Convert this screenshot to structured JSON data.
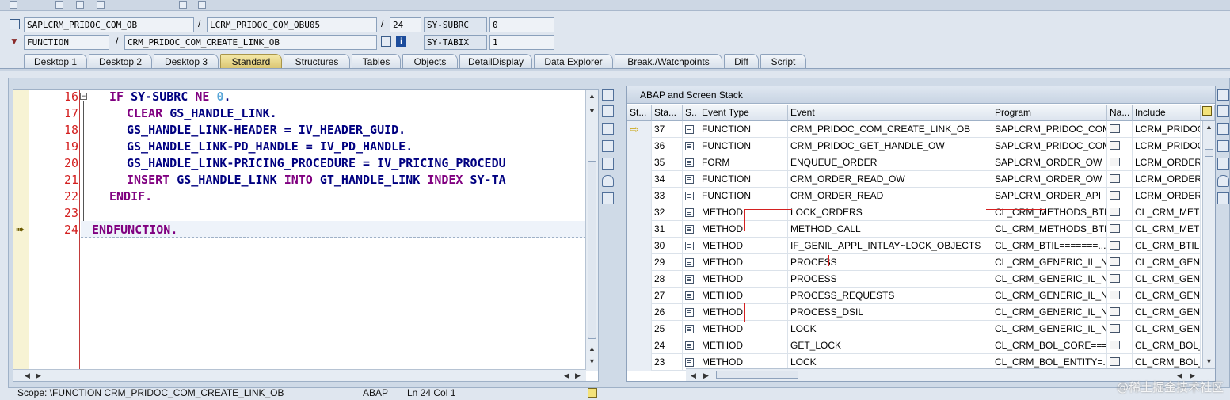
{
  "header": {
    "row1": {
      "program": "SAPLCRM_PRIDOC_COM_OB",
      "include": "LCRM_PRIDOC_COM_OBU05",
      "line": "24",
      "var_name": "SY-SUBRC",
      "var_value": "0",
      "sep": "/"
    },
    "row2": {
      "event_type": "FUNCTION",
      "event": "CRM_PRIDOC_COM_CREATE_LINK_OB",
      "var_name": "SY-TABIX",
      "var_value": "1",
      "sep": "/"
    }
  },
  "tabs": [
    {
      "label": "Desktop 1"
    },
    {
      "label": "Desktop 2"
    },
    {
      "label": "Desktop 3"
    },
    {
      "label": "Standard"
    },
    {
      "label": "Structures"
    },
    {
      "label": "Tables"
    },
    {
      "label": "Objects"
    },
    {
      "label": "DetailDisplay"
    },
    {
      "label": "Data Explorer"
    },
    {
      "label": "Break./Watchpoints"
    },
    {
      "label": "Diff"
    },
    {
      "label": "Script"
    }
  ],
  "active_tab": "Standard",
  "editor": {
    "lines": [
      {
        "num": "16",
        "p1": "IF ",
        "p2": "SY-SUBRC ",
        "p3": "NE ",
        "p4": "0",
        "p5": "."
      },
      {
        "num": "17",
        "p1": "CLEAR ",
        "p2": "GS_HANDLE_LINK."
      },
      {
        "num": "18",
        "p1": "GS_HANDLE_LINK-HEADER = IV_HEADER_GUID."
      },
      {
        "num": "19",
        "p1": "GS_HANDLE_LINK-PD_HANDLE = IV_PD_HANDLE."
      },
      {
        "num": "20",
        "p1": "GS_HANDLE_LINK-PRICING_PROCEDURE = IV_PRICING_PROCEDU"
      },
      {
        "num": "21",
        "p1": "INSERT ",
        "p2": "GS_HANDLE_LINK ",
        "p3": "INTO ",
        "p4": "GT_HANDLE_LINK ",
        "p5": "INDEX ",
        "p6": "SY-TA"
      },
      {
        "num": "22",
        "p1": "ENDIF."
      },
      {
        "num": "23"
      },
      {
        "num": "24",
        "p1": "ENDFUNCTION."
      }
    ]
  },
  "status_bar": {
    "scope": "Scope: \\FUNCTION CRM_PRIDOC_COM_CREATE_LINK_OB",
    "language": "ABAP",
    "position": "Ln  24 Col   1"
  },
  "stack": {
    "title": "ABAP and Screen Stack",
    "columns": [
      "St...",
      "Sta...",
      "S..",
      "Event Type",
      "Event",
      "Program",
      "Na...",
      "Include"
    ],
    "rows": [
      {
        "level": "37",
        "event_type": "FUNCTION",
        "event": "CRM_PRIDOC_COM_CREATE_LINK_OB",
        "program": "SAPLCRM_PRIDOC_COM...",
        "include": "LCRM_PRIDOC_"
      },
      {
        "level": "36",
        "event_type": "FUNCTION",
        "event": "CRM_PRIDOC_GET_HANDLE_OW",
        "program": "SAPLCRM_PRIDOC_COM...",
        "include": "LCRM_PRIDOC_"
      },
      {
        "level": "35",
        "event_type": "FORM",
        "event": "ENQUEUE_ORDER",
        "program": "SAPLCRM_ORDER_OW",
        "include": "LCRM_ORDER_("
      },
      {
        "level": "34",
        "event_type": "FUNCTION",
        "event": "CRM_ORDER_READ_OW",
        "program": "SAPLCRM_ORDER_OW",
        "include": "LCRM_ORDER_("
      },
      {
        "level": "33",
        "event_type": "FUNCTION",
        "event": "CRM_ORDER_READ",
        "program": "SAPLCRM_ORDER_API",
        "include": "LCRM_ORDER_A"
      },
      {
        "level": "32",
        "event_type": "METHOD",
        "event": "LOCK_ORDERS",
        "program": "CL_CRM_METHODS_BTIL...",
        "include": "CL_CRM_METHO"
      },
      {
        "level": "31",
        "event_type": "METHOD",
        "event": "METHOD_CALL",
        "program": "CL_CRM_METHODS_BTIL...",
        "include": "CL_CRM_METHO"
      },
      {
        "level": "30",
        "event_type": "METHOD",
        "event": "IF_GENIL_APPL_INTLAY~LOCK_OBJECTS",
        "program": "CL_CRM_BTIL=======...",
        "include": "CL_CRM_BTIL="
      },
      {
        "level": "29",
        "event_type": "METHOD",
        "event": "PROCESS",
        "program": "CL_CRM_GENERIC_IL_NE...",
        "include": "CL_CRM_GENEF"
      },
      {
        "level": "28",
        "event_type": "METHOD",
        "event": "PROCESS",
        "program": "CL_CRM_GENERIC_IL_NE...",
        "include": "CL_CRM_GENEF"
      },
      {
        "level": "27",
        "event_type": "METHOD",
        "event": "PROCESS_REQUESTS",
        "program": "CL_CRM_GENERIC_IL_NE...",
        "include": "CL_CRM_GENEF"
      },
      {
        "level": "26",
        "event_type": "METHOD",
        "event": "PROCESS_DSIL",
        "program": "CL_CRM_GENERIC_IL_NE...",
        "include": "CL_CRM_GENEF"
      },
      {
        "level": "25",
        "event_type": "METHOD",
        "event": "LOCK",
        "program": "CL_CRM_GENERIC_IL_NE...",
        "include": "CL_CRM_GENEF"
      },
      {
        "level": "24",
        "event_type": "METHOD",
        "event": "GET_LOCK",
        "program": "CL_CRM_BOL_CORE===...",
        "include": "CL_CRM_BOL_C"
      },
      {
        "level": "23",
        "event_type": "METHOD",
        "event": "LOCK",
        "program": "CL_CRM_BOL_ENTITY=...",
        "include": "CL_CRM_BOL_E"
      }
    ]
  },
  "watermark": "@稀土掘金技术社区",
  "colors": {
    "keyword": "#800080",
    "identifier": "#000080",
    "number": "#5aa7d8",
    "line_number": "#d42020",
    "active_tab": "#d9c470",
    "annotation": "#d42020"
  }
}
